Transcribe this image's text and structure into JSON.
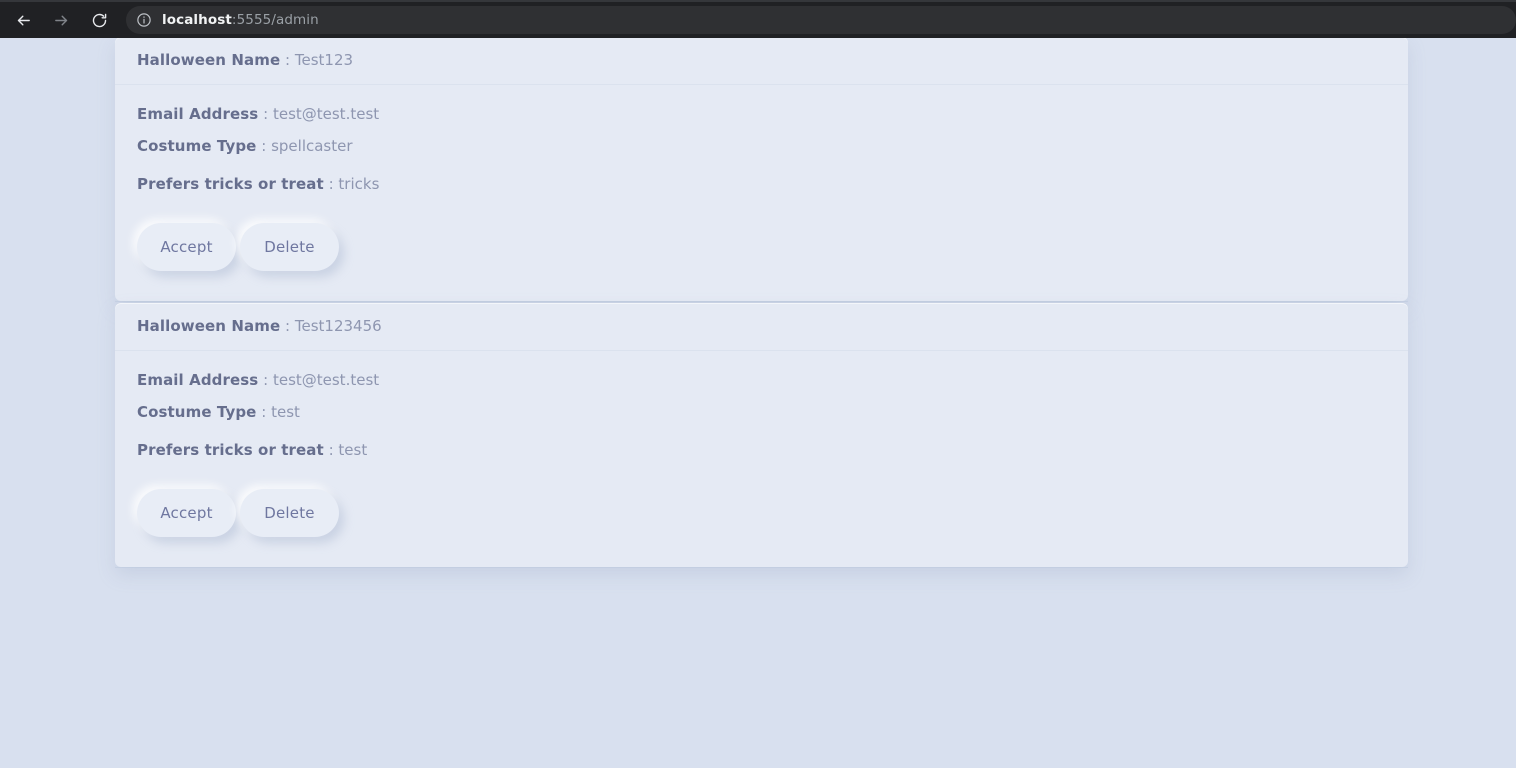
{
  "browser": {
    "back_icon": "arrow-left-icon",
    "forward_icon": "arrow-right-icon",
    "reload_icon": "reload-icon",
    "site_info_icon": "info-circle-icon",
    "url_host": "localhost",
    "url_rest": ":5555/admin",
    "url_full": "localhost:5555/admin"
  },
  "colors": {
    "page_background": "#d8e0ef",
    "card_background": "#e5eaf4",
    "label_text": "#666e8d",
    "value_text": "#8e96b0",
    "button_background": "#e8edf6",
    "button_text": "#6f77a0",
    "chrome_background": "#202124",
    "omnibox_background": "#2f3033"
  },
  "labels": {
    "name": "Halloween Name",
    "email": "Email Address",
    "costume": "Costume Type",
    "preference": "Prefers tricks or treat",
    "separator": ":"
  },
  "actions": {
    "accept": "Accept",
    "delete": "Delete"
  },
  "cards": [
    {
      "name": "Test123",
      "email": "test@test.test",
      "costume": "spellcaster",
      "preference": "tricks"
    },
    {
      "name": "Test123456",
      "email": "test@test.test",
      "costume": "test",
      "preference": "test"
    }
  ]
}
